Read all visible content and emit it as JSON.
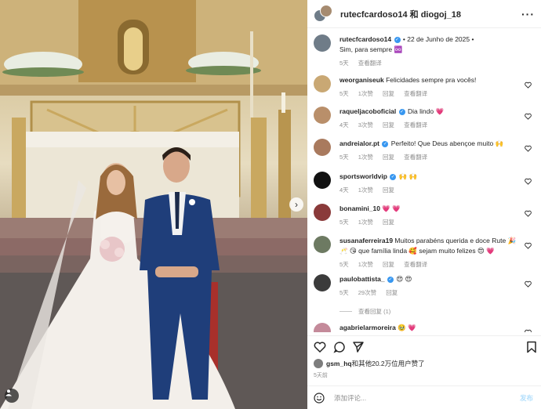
{
  "header": {
    "names": "rutecfcardoso14 和 diogoj_18",
    "more": "···"
  },
  "caption": {
    "username": "rutecfcardoso14",
    "date": "• 22 de Junho de 2025 •",
    "text": "Sim, para sempre ♾️",
    "time": "5天",
    "translate": "查看翻译"
  },
  "comments": [
    {
      "username": "weorganiseuk",
      "verified": false,
      "text": "Felicidades sempre pra vocês!",
      "time": "5天",
      "likes": "1次赞",
      "reply": "回复",
      "translate": "查看翻译",
      "avatar_color": "#c9a874"
    },
    {
      "username": "raqueljacoboficial",
      "verified": true,
      "text": "Dia lindo 💗",
      "time": "4天",
      "likes": "3次赞",
      "reply": "回复",
      "translate": "查看翻译",
      "avatar_color": "#b98f6a"
    },
    {
      "username": "andreialor.pt",
      "verified": true,
      "text": "Perfeito! Que Deus abençoe muito 🙌",
      "time": "5天",
      "likes": "1次赞",
      "reply": "回复",
      "translate": "查看翻译",
      "avatar_color": "#a97a5e"
    },
    {
      "username": "sportsworldvip",
      "verified": true,
      "text": "🙌 🙌",
      "time": "4天",
      "likes": "1次赞",
      "reply": "回复",
      "translate": "",
      "avatar_color": "#111111"
    },
    {
      "username": "bonamini_10",
      "verified": false,
      "text": "💗 💗",
      "time": "5天",
      "likes": "1次赞",
      "reply": "回复",
      "translate": "",
      "avatar_color": "#8a3a3a"
    },
    {
      "username": "susanaferreira19",
      "verified": false,
      "text": "Muitos parabéns querida e doce Rute 🎉 🥂 😘 que família linda 🥰 sejam muito felizes 😍 💗",
      "time": "5天",
      "likes": "1次赞",
      "reply": "回复",
      "translate": "查看翻译",
      "avatar_color": "#6d7a62"
    },
    {
      "username": "paulobattista_",
      "verified": true,
      "text": "😍 😍",
      "time": "5天",
      "likes": "29次赞",
      "reply": "回复",
      "translate": "",
      "avatar_color": "#3b3b3b"
    },
    {
      "username": "agabrielarmoreira",
      "verified": false,
      "text": "🥹 💗",
      "time": "",
      "likes": "",
      "reply": "",
      "translate": "",
      "avatar_color": "#c48a9a"
    }
  ],
  "view_replies": "查看回复 (1)",
  "likes": {
    "user": "gsm_hq",
    "rest": "和其他20.2万位用户赞了"
  },
  "post_time": "5天前",
  "add_comment": {
    "placeholder": "添加评论...",
    "post": "发布"
  },
  "icons": {
    "like": "heart-icon",
    "comment": "comment-bubble-icon",
    "share": "paper-plane-icon",
    "save": "bookmark-icon",
    "emoji": "smiley-icon",
    "more": "more-dots-icon",
    "next": "chevron-right-icon",
    "user_tag": "user-tag-icon"
  },
  "colors": {
    "verified": "#3897f0",
    "secondary_text": "#8e8e8e",
    "post_button": "#b2dffc"
  }
}
